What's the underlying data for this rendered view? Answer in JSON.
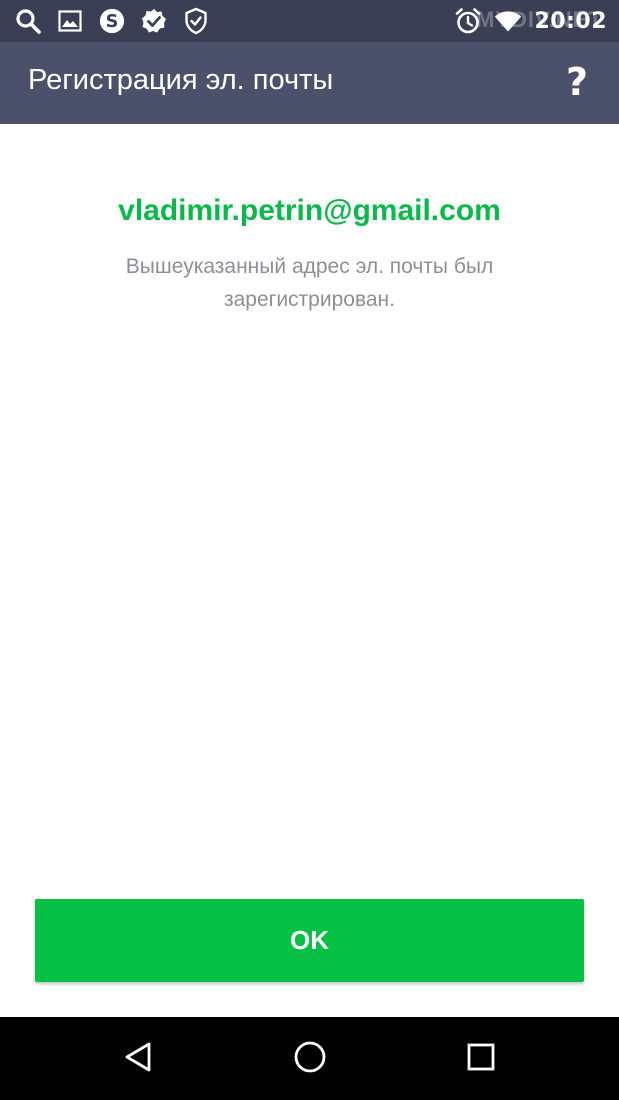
{
  "status_bar": {
    "left_icons": [
      "search-icon",
      "image-icon",
      "skype-icon",
      "check-badge-icon",
      "shield-check-icon"
    ],
    "right_icons": [
      "alarm-icon",
      "wifi-icon"
    ],
    "time": "20:02",
    "watermark": "MYDIV.NET"
  },
  "app_bar": {
    "title": "Регистрация эл. почты",
    "help_icon": "help-icon",
    "help_glyph": "?"
  },
  "content": {
    "email": "vladimir.petrin@gmail.com",
    "message": "Вышеуказанный адрес эл. почты был зарегистрирован."
  },
  "actions": {
    "ok_label": "OK"
  },
  "nav_bar": {
    "icons": [
      "back-icon",
      "home-icon",
      "recents-icon"
    ]
  },
  "colors": {
    "status_bar_bg": "#3b3f55",
    "app_bar_bg": "#4b506b",
    "accent_green": "#0ab94a",
    "button_green": "#07c046",
    "message_gray": "#8d8f96"
  }
}
